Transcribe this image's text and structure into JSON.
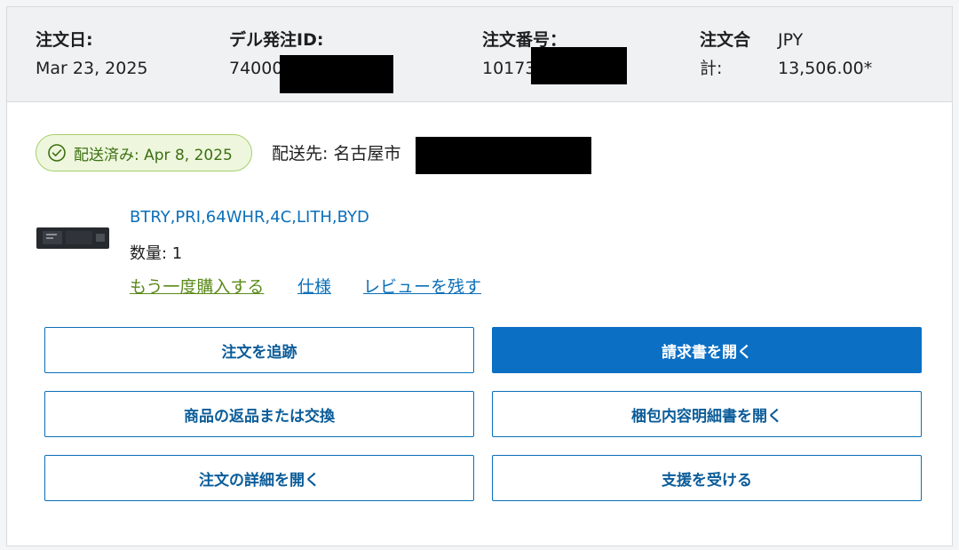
{
  "header": {
    "order_date": {
      "label": "注文日:",
      "value": "Mar 23, 2025"
    },
    "dell_order_id": {
      "label": "デル発注ID:",
      "value": "74000"
    },
    "order_number": {
      "label": "注文番号：",
      "value": "10173"
    },
    "order_total": {
      "label_line1": "注文合",
      "label_line2": "計:",
      "currency": "JPY",
      "value": "13,506.00*"
    }
  },
  "shipment": {
    "status": "配送済み: Apr 8, 2025",
    "ship_to_label": "配送先:",
    "ship_to_city": "名古屋市"
  },
  "item": {
    "name": "BTRY,PRI,64WHR,4C,LITH,BYD",
    "quantity": "数量: 1",
    "links": {
      "buy_again": "もう一度購入する",
      "specs": "仕様",
      "review": "レビューを残す"
    }
  },
  "actions": {
    "track_order": "注文を追跡",
    "open_invoice": "請求書を開く",
    "return_exchange": "商品の返品または交換",
    "open_packing_slip": "梱包内容明細書を開く",
    "open_order_details": "注文の詳細を開く",
    "get_support": "支援を受ける"
  },
  "colors": {
    "primary_blue": "#0b6fc4",
    "link_blue": "#0b6fb8",
    "link_green": "#5b8a1a",
    "status_green_bg": "#eef7dd",
    "status_green_border": "#a6cf6b"
  },
  "icons": {
    "status": "check-circle-icon",
    "product": "battery-product-image"
  }
}
